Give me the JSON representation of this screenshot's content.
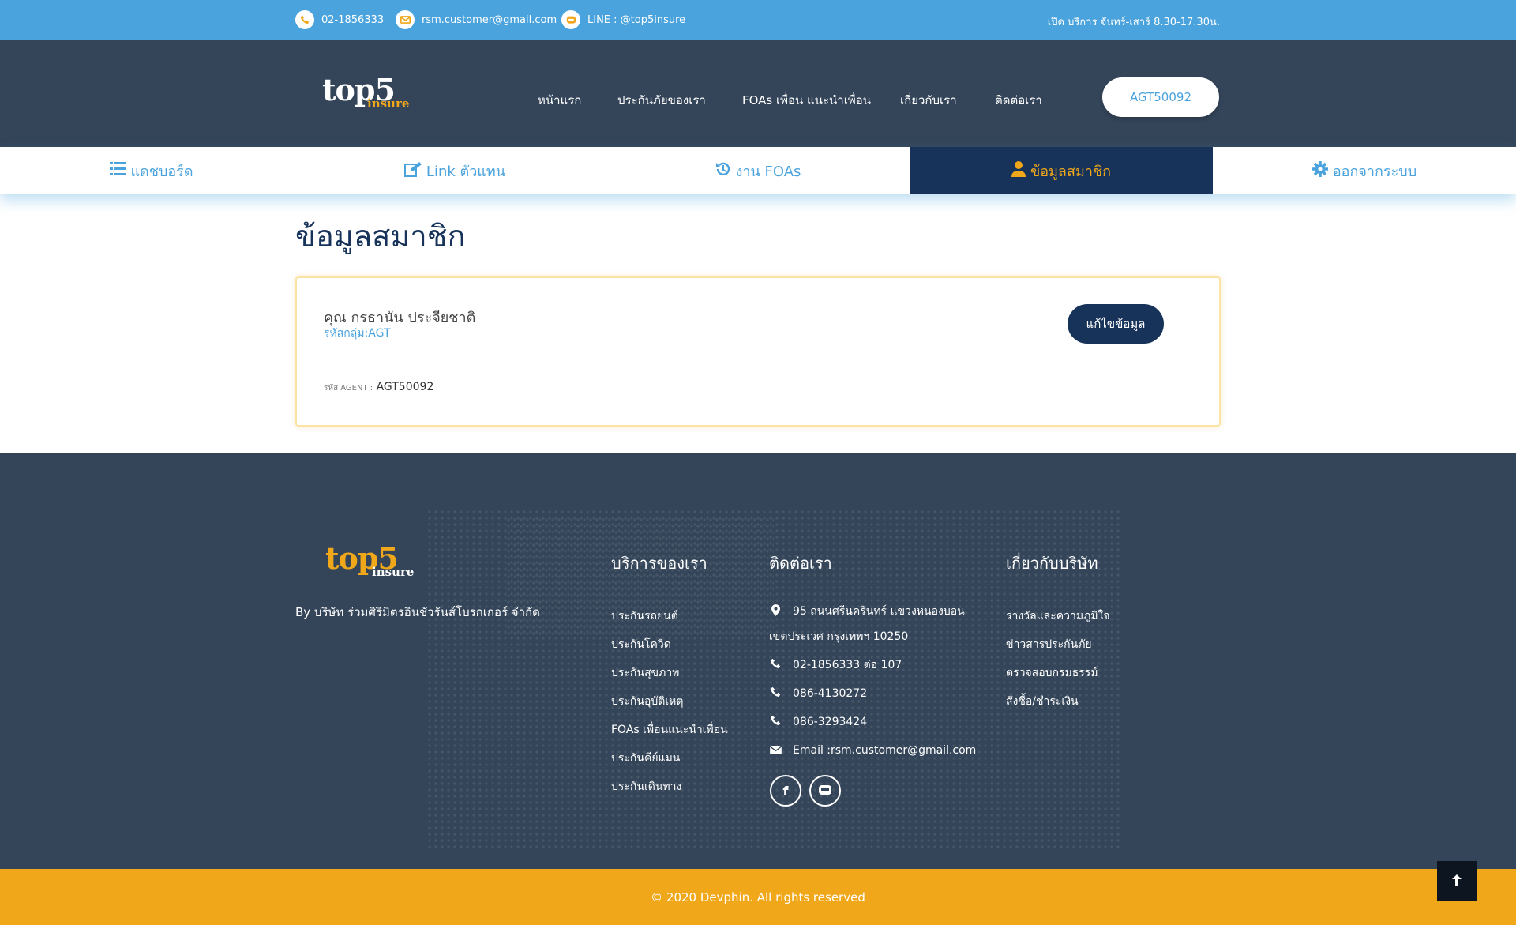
{
  "topbar": {
    "phone": "02-1856333",
    "email": "rsm.customer@gmail.com",
    "line": "LINE : @top5insure",
    "hours": "เปิด บริการ จันทร์-เสาร์ 8.30-17.30น."
  },
  "logo": {
    "main": "top5",
    "sub": "insure"
  },
  "nav": {
    "items": [
      {
        "label": "หน้าแรก"
      },
      {
        "label": "ประกันภัยของเรา"
      },
      {
        "label": "FOAs เพื่อน แนะนำเพื่อน"
      },
      {
        "label": "เกี่ยวกับเรา"
      },
      {
        "label": "ติดต่อเรา"
      }
    ],
    "agent_code": "AGT50092"
  },
  "tabs": [
    {
      "label": "แดชบอร์ด",
      "icon": "list-icon"
    },
    {
      "label": "Link ตัวแทน",
      "icon": "edit-icon"
    },
    {
      "label": "งาน FOAs",
      "icon": "history-icon"
    },
    {
      "label": "ข้อมูลสมาชิก",
      "icon": "user-icon",
      "active": true
    },
    {
      "label": "ออกจากระบบ",
      "icon": "gear-icon"
    }
  ],
  "page": {
    "title": "ข้อมูลสมาชิก",
    "member_name": "คุณ กรธานัน ประจียชาติ",
    "member_group": "รหัสกลุ่ม:AGT",
    "agent_label": "รหัส AGENT :",
    "agent_code": "AGT50092",
    "edit_label": "แก้ไขข้อมูล"
  },
  "footer": {
    "company": "By บริษัท ร่วมศิริมิตรอินชัวรันส์โบรกเกอร์ จำกัด",
    "services_title": "บริการของเรา",
    "services": [
      "ประกันรถยนต์",
      "ประกันโควิด",
      "ประกันสุขภาพ",
      "ประกันอุบัติเหตุ",
      "FOAs เพื่อนแนะนำเพื่อน",
      "ประกันคีย์แมน",
      "ประกันเดินทาง"
    ],
    "contact_title": "ติดต่อเรา",
    "address_line1": "95 ถนนศรีนครินทร์ แขวงหนองบอน",
    "address_line2": "เขตประเวศ กรุงเทพฯ 10250",
    "phones": [
      "02-1856333 ต่อ 107",
      "086-4130272",
      "086-3293424"
    ],
    "email": "Email :rsm.customer@gmail.com",
    "about_title": "เกี่ยวกับบริษัท",
    "about": [
      "รางวัลและความภูมิใจ",
      "ข่าวสารประกันภัย",
      "ตรวจสอบกรมธรรม์",
      "สั่งซื้อ/ชำระเงิน"
    ],
    "copyright": "© 2020 Devphin. All rights reserved"
  }
}
